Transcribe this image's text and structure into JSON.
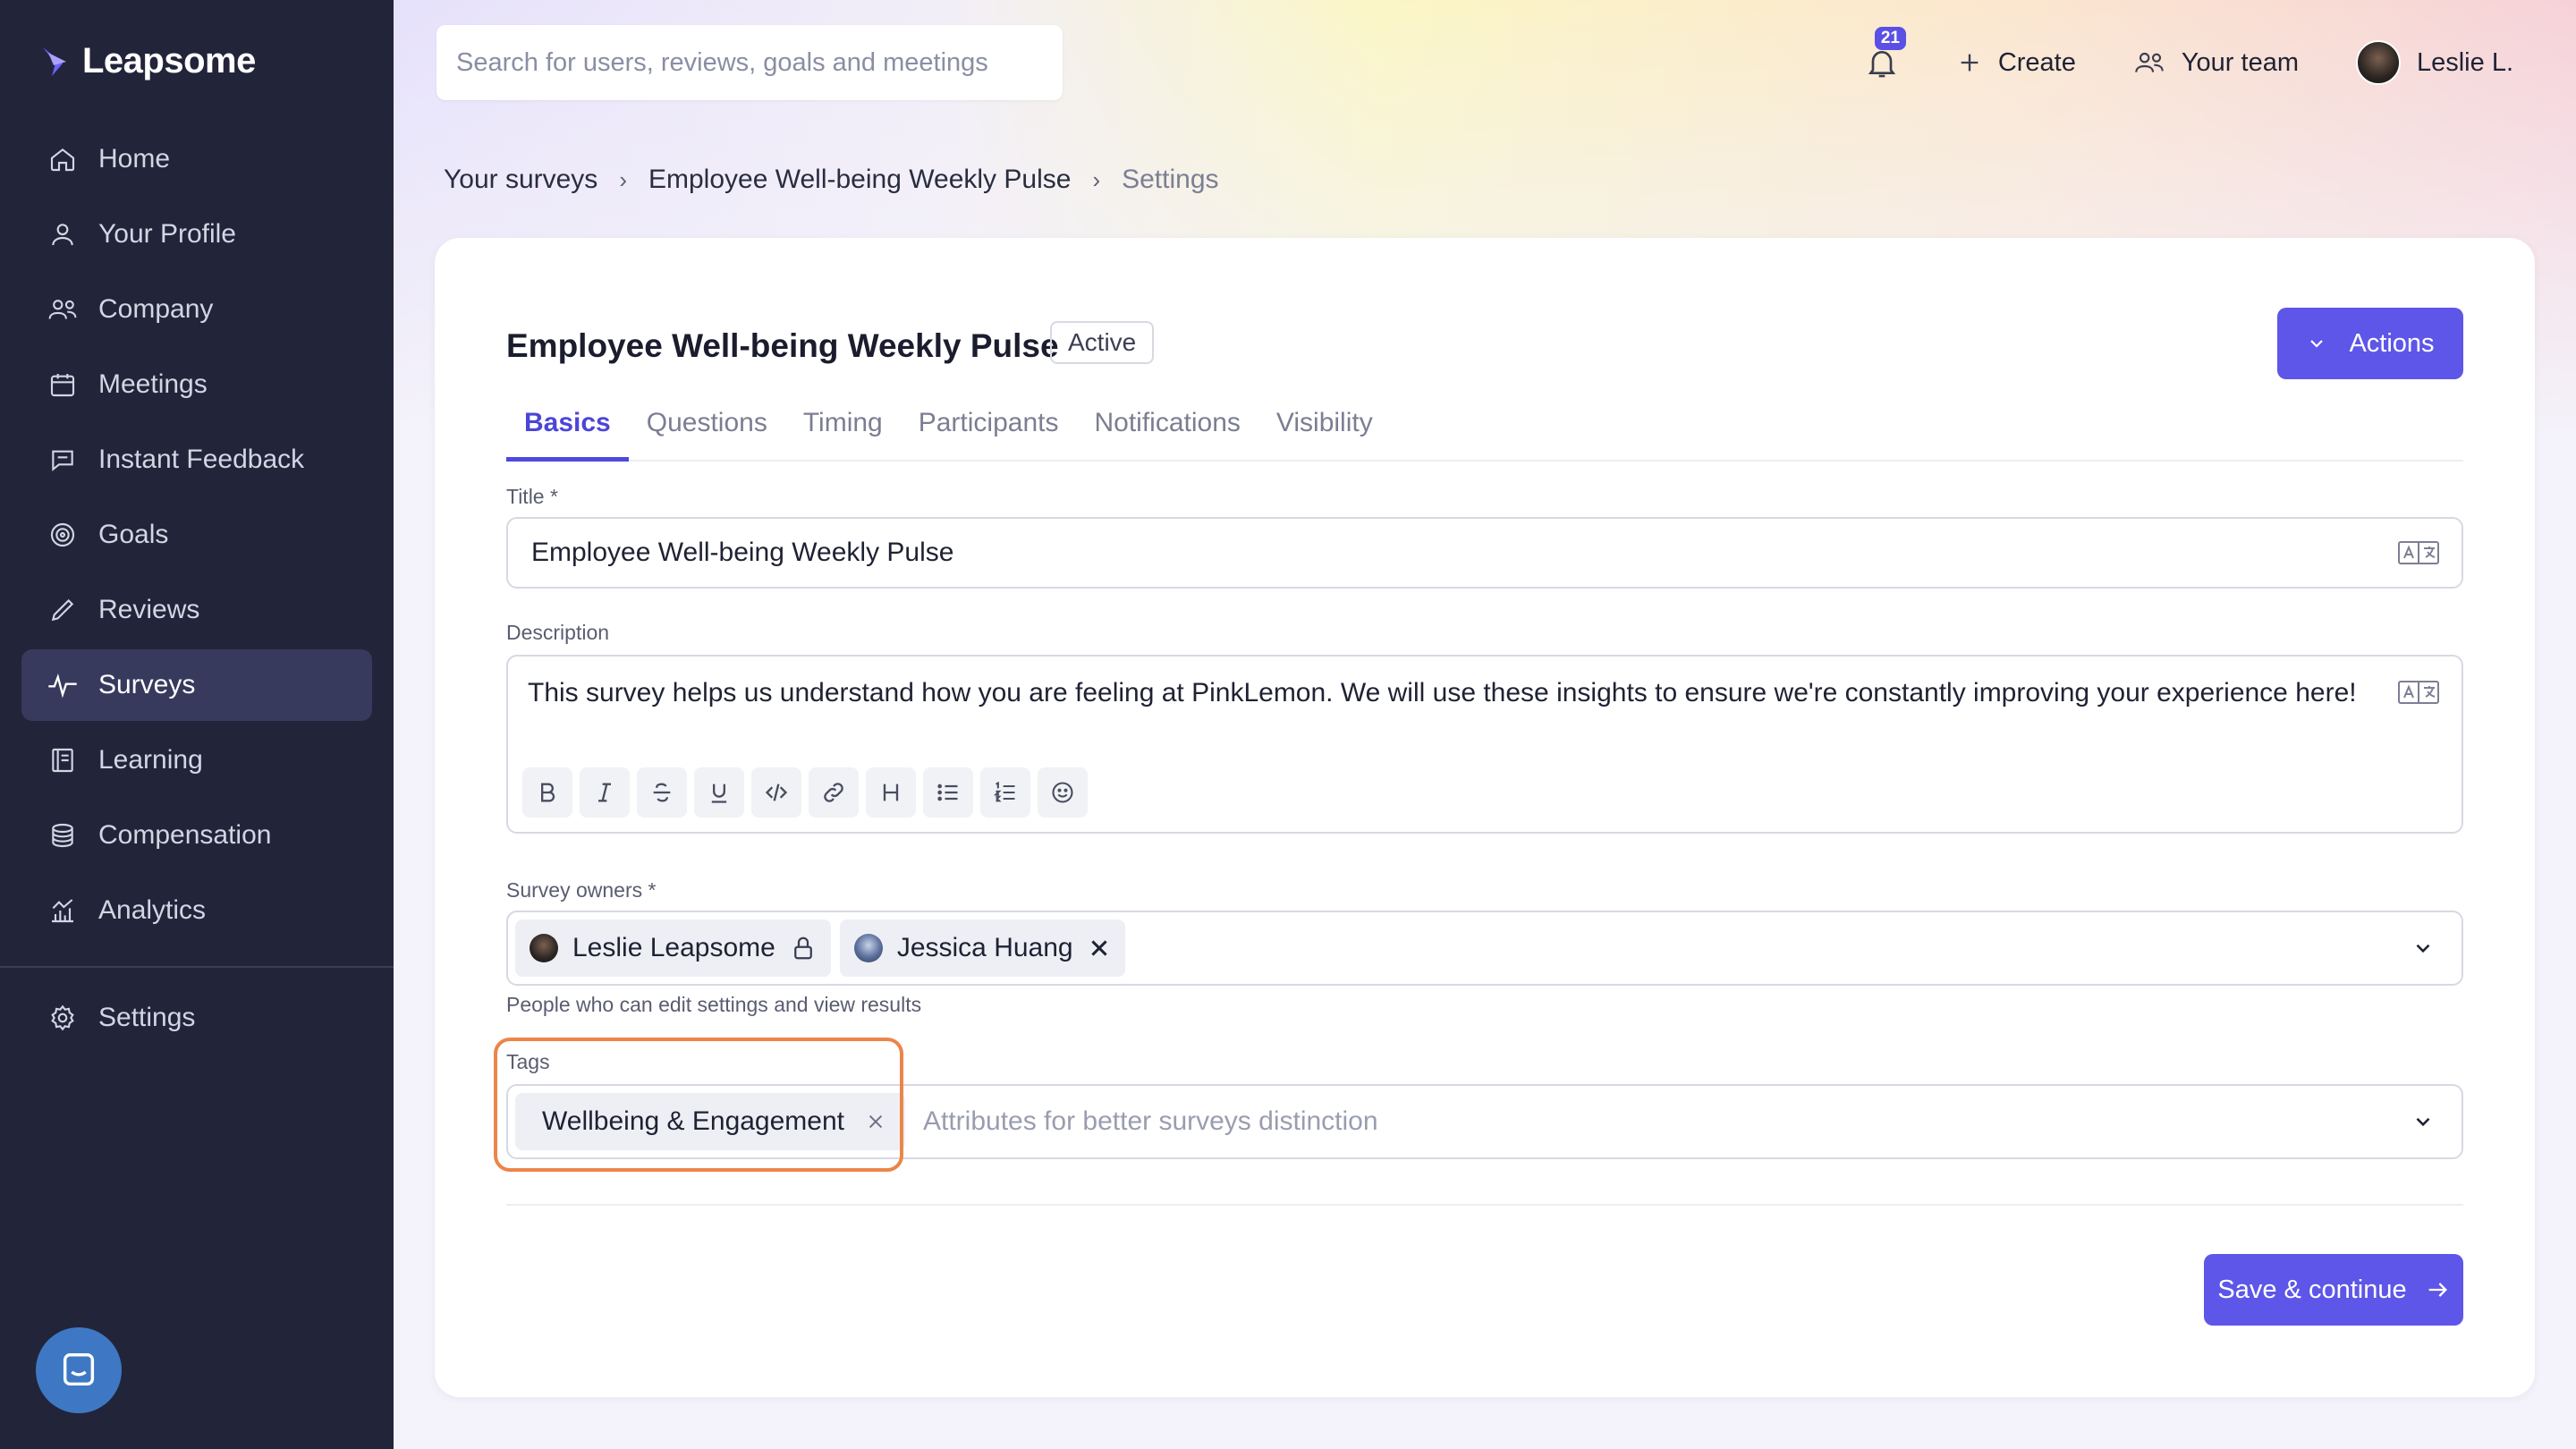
{
  "app": {
    "brand": "Leapsome"
  },
  "sidebar": {
    "items": [
      {
        "label": "Home",
        "icon": "home-icon"
      },
      {
        "label": "Your Profile",
        "icon": "user-icon"
      },
      {
        "label": "Company",
        "icon": "users-icon"
      },
      {
        "label": "Meetings",
        "icon": "calendar-icon"
      },
      {
        "label": "Instant Feedback",
        "icon": "chat-icon"
      },
      {
        "label": "Goals",
        "icon": "target-icon"
      },
      {
        "label": "Reviews",
        "icon": "pencil-icon"
      },
      {
        "label": "Surveys",
        "icon": "pulse-icon",
        "active": true
      },
      {
        "label": "Learning",
        "icon": "book-icon"
      },
      {
        "label": "Compensation",
        "icon": "coins-icon"
      },
      {
        "label": "Analytics",
        "icon": "bar-chart-icon"
      }
    ],
    "settings": {
      "label": "Settings",
      "icon": "gear-icon"
    }
  },
  "header": {
    "search_placeholder": "Search for users, reviews, goals and meetings",
    "notifications_count": "21",
    "create_label": "Create",
    "team_label": "Your team",
    "user_name": "Leslie L."
  },
  "breadcrumb": {
    "items": [
      "Your surveys",
      "Employee Well-being Weekly Pulse"
    ],
    "current": "Settings"
  },
  "survey": {
    "title": "Employee Well-being Weekly Pulse",
    "status": "Active",
    "actions_label": "Actions",
    "tabs": [
      "Basics",
      "Questions",
      "Timing",
      "Participants",
      "Notifications",
      "Visibility"
    ],
    "active_tab": "Basics"
  },
  "form": {
    "title_label": "Title *",
    "title_value": "Employee Well-being Weekly Pulse",
    "description_label": "Description",
    "description_value": "This survey helps us understand how you are feeling at PinkLemon. We will use these insights to ensure we're constantly improving your experience here!",
    "owners_label": "Survey owners *",
    "owners": [
      {
        "name": "Leslie Leapsome",
        "locked": true
      },
      {
        "name": "Jessica Huang",
        "locked": false
      }
    ],
    "owners_helper": "People who can edit settings and view results",
    "tags_label": "Tags",
    "tags": [
      "Wellbeing & Engagement"
    ],
    "tags_placeholder": "Attributes for better surveys distinction",
    "save_label": "Save & continue"
  },
  "colors": {
    "sidebar_bg": "#22243a",
    "accent": "#5d56e8",
    "highlight": "#ec8549"
  }
}
